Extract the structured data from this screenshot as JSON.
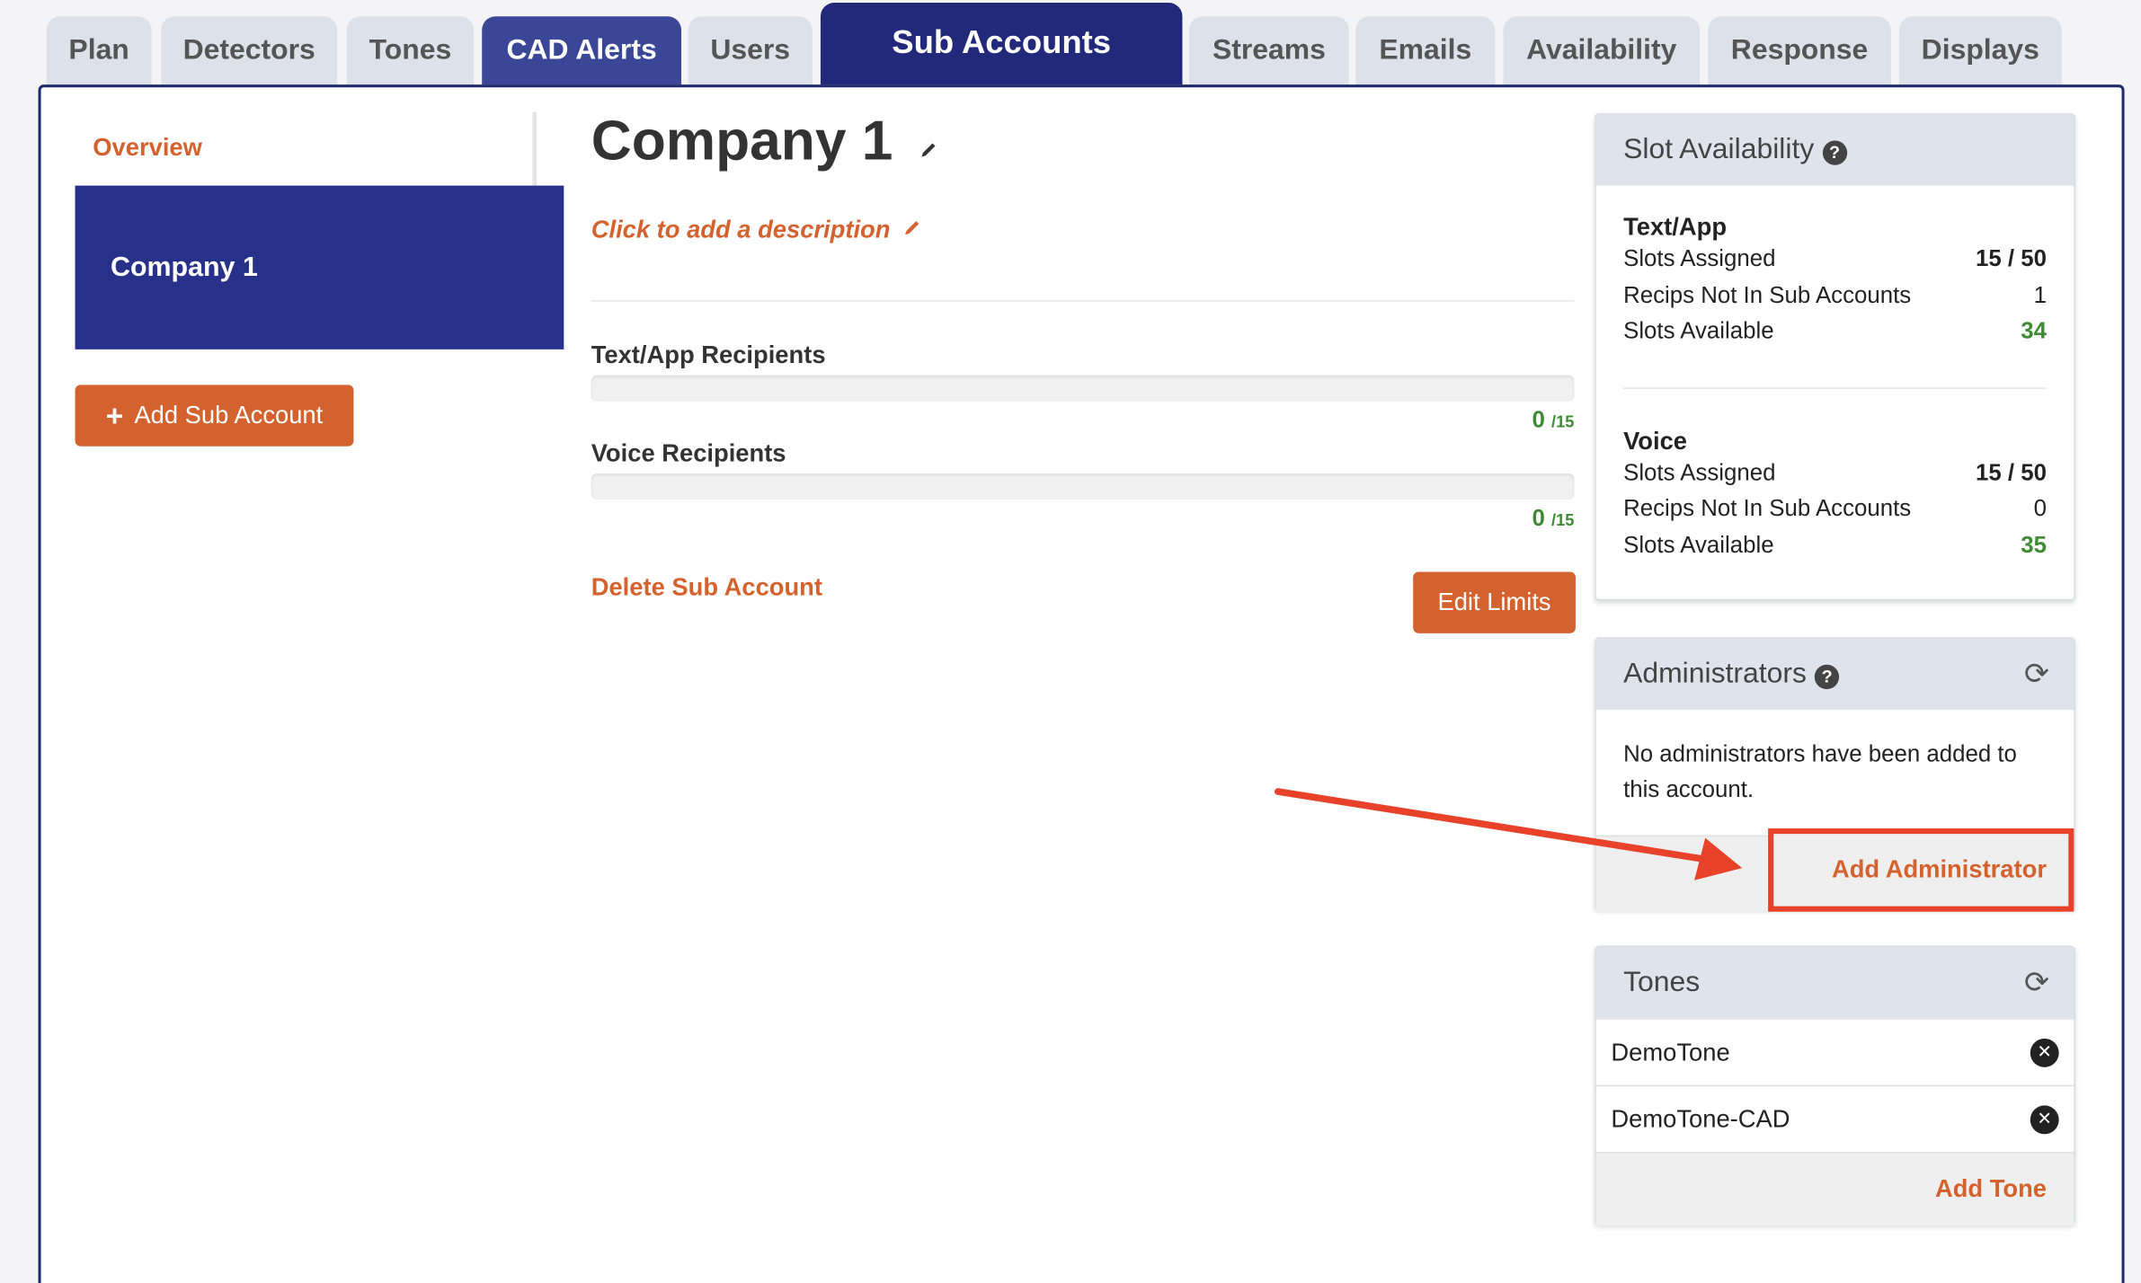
{
  "tabs": [
    "Plan",
    "Detectors",
    "Tones",
    "CAD Alerts",
    "Users",
    "Sub Accounts",
    "Streams",
    "Emails",
    "Availability",
    "Response",
    "Displays"
  ],
  "active_tab": "Sub Accounts",
  "sidebar": {
    "overview": "Overview",
    "selected_account": "Company 1",
    "add_button": "Add Sub Account"
  },
  "main": {
    "title": "Company 1",
    "description_prompt": "Click to add a description",
    "text_recipients": {
      "label": "Text/App Recipients",
      "count": "0",
      "limit": "/15",
      "fraction": 0
    },
    "voice_recipients": {
      "label": "Voice Recipients",
      "count": "0",
      "limit": "/15",
      "fraction": 0
    },
    "delete_link": "Delete Sub Account",
    "edit_limits": "Edit Limits"
  },
  "slot_card": {
    "title": "Slot Availability",
    "sections": [
      {
        "heading": "Text/App",
        "rows": [
          {
            "label": "Slots Assigned",
            "value": "15 / 50"
          },
          {
            "label": "Recips Not In Sub Accounts",
            "value": "1"
          },
          {
            "label": "Slots Available",
            "value": "34"
          }
        ]
      },
      {
        "heading": "Voice",
        "rows": [
          {
            "label": "Slots Assigned",
            "value": "15 / 50"
          },
          {
            "label": "Recips Not In Sub Accounts",
            "value": "0"
          },
          {
            "label": "Slots Available",
            "value": "35"
          }
        ]
      }
    ]
  },
  "admin_card": {
    "title": "Administrators",
    "empty_text": "No administrators have been added to this account.",
    "add_button": "Add Administrator"
  },
  "tones_card": {
    "title": "Tones",
    "items": [
      "DemoTone",
      "DemoTone-CAD"
    ],
    "add_link": "Add Tone"
  },
  "colors": {
    "accent": "#d4622f",
    "nav_active": "#22297a",
    "success": "#3e8a35",
    "annotation": "#e8432a"
  }
}
